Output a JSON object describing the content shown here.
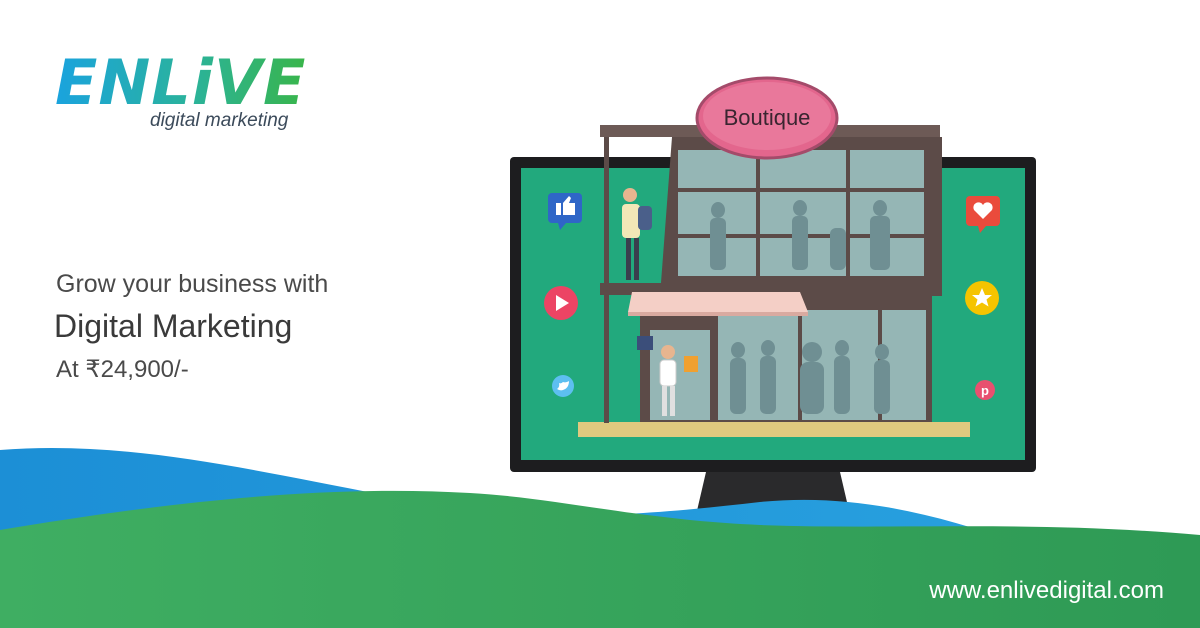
{
  "brand": {
    "name": "ENLiVE",
    "tagline": "digital marketing"
  },
  "headline": {
    "line1": "Grow your business with",
    "line2": "Digital Marketing",
    "line3": "At ₹24,900/-"
  },
  "store": {
    "sign": "Boutique"
  },
  "footer": {
    "url": "www.enlivedigital.com"
  },
  "icons": [
    "thumbs-up-icon",
    "heart-icon",
    "play-icon",
    "star-icon",
    "twitter-icon",
    "pinterest-icon"
  ],
  "colors": {
    "green": "#32a05a",
    "blue": "#1c8fd6",
    "screen": "#22a97d",
    "sign": "#e3668d"
  }
}
